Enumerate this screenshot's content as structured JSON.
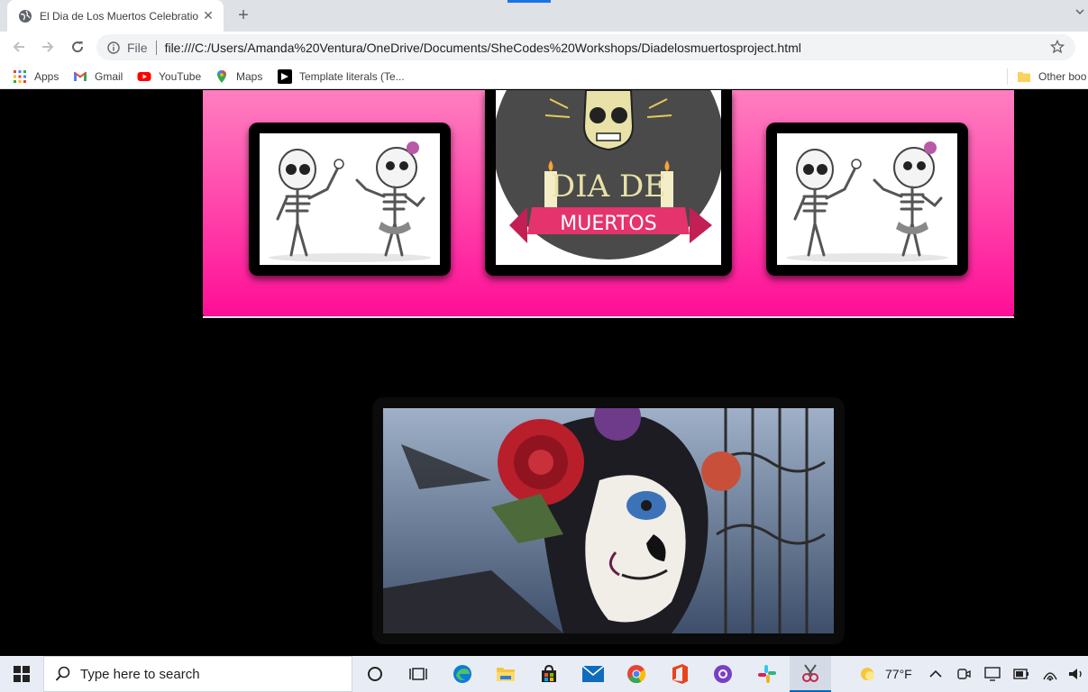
{
  "browser": {
    "tab_title": "El Dia de Los Muertos Celebratio",
    "new_tab_symbol": "+",
    "close_symbol": "✕",
    "address": {
      "scheme_label": "File",
      "url": "file:///C:/Users/Amanda%20Ventura/OneDrive/Documents/SheCodes%20Workshops/Diadelosmuertosproject.html"
    },
    "bookmarks": [
      {
        "label": "Apps",
        "icon": "apps-grid-icon"
      },
      {
        "label": "Gmail",
        "icon": "gmail-icon"
      },
      {
        "label": "YouTube",
        "icon": "youtube-icon"
      },
      {
        "label": "Maps",
        "icon": "maps-icon"
      },
      {
        "label": "Template literals (Te...",
        "icon": "codepen-icon"
      }
    ],
    "other_bookmarks_label": "Other boo"
  },
  "page": {
    "banner_color_top": "#ff7fc0",
    "banner_color_bottom": "#ff0d96",
    "logo_text_top": "DIA DE",
    "logo_text_ribbon": "MUERTOS",
    "images": [
      {
        "name": "dancing-skeletons-image-left",
        "subject": "skeletons dancing"
      },
      {
        "name": "dia-de-muertos-logo",
        "subject": "sugar skull logo"
      },
      {
        "name": "dancing-skeletons-image-right",
        "subject": "skeletons dancing"
      },
      {
        "name": "catrina-photo",
        "subject": "woman with sugar skull makeup and red roses"
      }
    ]
  },
  "taskbar": {
    "search_placeholder": "Type here to search",
    "weather_temp": "77°F",
    "pinned": [
      "task-view-icon",
      "widgets-icon",
      "edge-icon",
      "file-explorer-icon",
      "store-icon",
      "mail-icon",
      "chrome-icon",
      "office-icon",
      "github-desktop-icon",
      "slack-icon",
      "snip-sketch-icon"
    ]
  }
}
